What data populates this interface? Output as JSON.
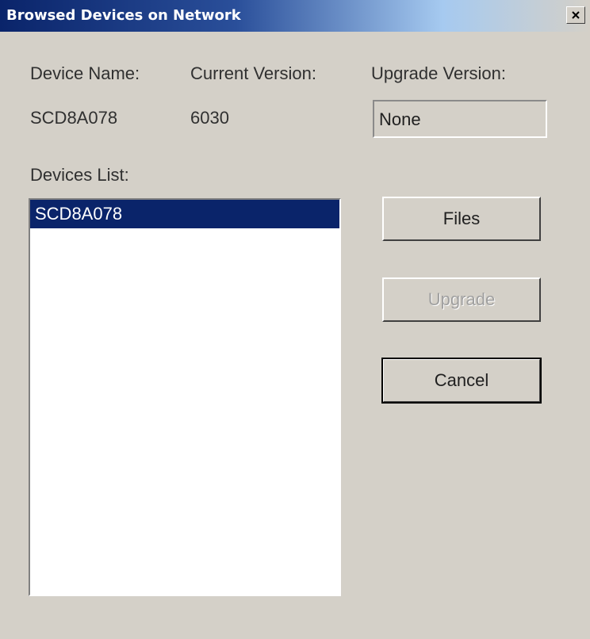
{
  "window": {
    "title": "Browsed Devices on Network",
    "close_glyph": "✕"
  },
  "header": {
    "device_name_label": "Device Name:",
    "current_version_label": "Current Version:",
    "upgrade_version_label": "Upgrade Version:"
  },
  "device": {
    "name": "SCD8A078",
    "current_version": "6030",
    "upgrade_version": "None"
  },
  "devices_list": {
    "label": "Devices List:",
    "items": [
      "SCD8A078"
    ]
  },
  "buttons": {
    "files": "Files",
    "upgrade": "Upgrade",
    "cancel": "Cancel"
  },
  "colors": {
    "title_start": "#0a246a",
    "selection": "#0a246a",
    "face": "#d4d0c8"
  }
}
